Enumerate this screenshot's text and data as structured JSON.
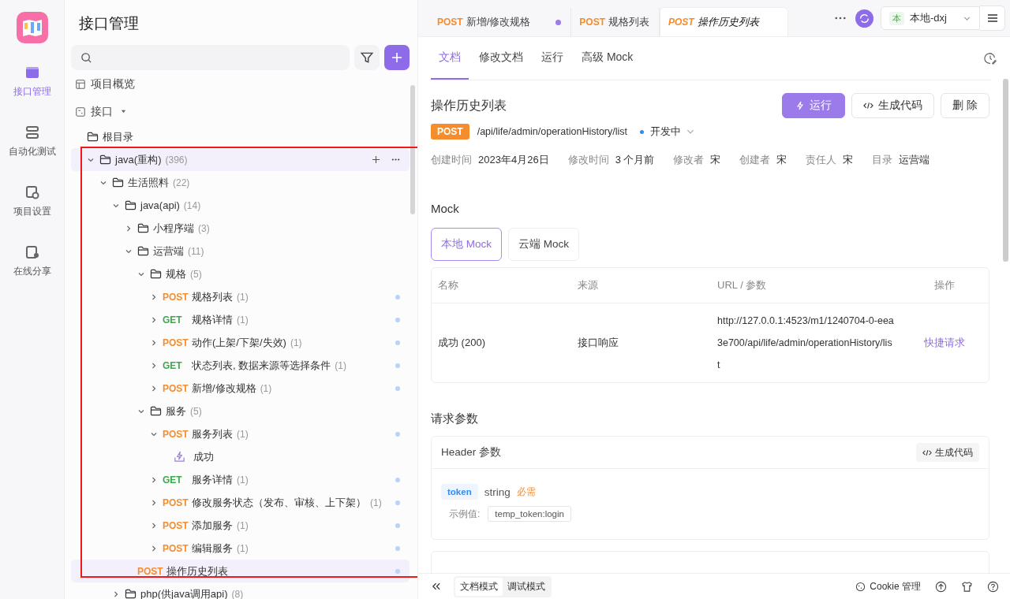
{
  "rail": [
    {
      "label": "接口管理",
      "selected": true
    },
    {
      "label": "自动化测试",
      "selected": false
    },
    {
      "label": "项目设置",
      "selected": false
    },
    {
      "label": "在线分享",
      "selected": false
    }
  ],
  "panel": {
    "title": "接口管理",
    "nav": [
      {
        "label": "项目概览",
        "dropdown": false
      },
      {
        "label": "接口",
        "dropdown": true
      }
    ]
  },
  "tree": [
    {
      "kind": "folder",
      "label": "根目录"
    },
    {
      "kind": "folder",
      "label": "java(重构)",
      "count": "(396)",
      "expanded": true,
      "hovered": true,
      "children": [
        {
          "kind": "folder",
          "label": "生活照料",
          "count": "(22)",
          "expanded": true,
          "children": [
            {
              "kind": "folder",
              "label": "java(api)",
              "count": "(14)",
              "expanded": true,
              "children": [
                {
                  "kind": "folder",
                  "label": "小程序端",
                  "count": "(3)",
                  "expanded": false
                },
                {
                  "kind": "folder",
                  "label": "运营端",
                  "count": "(11)",
                  "expanded": true,
                  "children": [
                    {
                      "kind": "folder",
                      "label": "规格",
                      "count": "(5)",
                      "expanded": true,
                      "children": [
                        {
                          "kind": "endpoint",
                          "method": "POST",
                          "label": "规格列表",
                          "count": "(1)",
                          "expanded": false,
                          "dot": true,
                          "selected": false
                        },
                        {
                          "kind": "endpoint",
                          "method": "GET",
                          "label": "规格详情",
                          "count": "(1)",
                          "expanded": false,
                          "dot": true,
                          "selected": false
                        },
                        {
                          "kind": "endpoint",
                          "method": "POST",
                          "label": "动作(上架/下架/失效)",
                          "count": "(1)",
                          "expanded": false,
                          "dot": true,
                          "selected": false
                        },
                        {
                          "kind": "endpoint",
                          "method": "GET",
                          "label": "状态列表, 数据来源等选择条件",
                          "count": "(1)",
                          "expanded": false,
                          "dot": true,
                          "selected": false
                        },
                        {
                          "kind": "endpoint",
                          "method": "POST",
                          "label": "新增/修改规格",
                          "count": "(1)",
                          "expanded": false,
                          "dot": true,
                          "selected": false
                        }
                      ]
                    },
                    {
                      "kind": "folder",
                      "label": "服务",
                      "count": "(5)",
                      "expanded": true,
                      "children": [
                        {
                          "kind": "endpoint",
                          "method": "POST",
                          "label": "服务列表",
                          "count": "(1)",
                          "expanded": true,
                          "dot": true,
                          "selected": false,
                          "children": [
                            {
                              "kind": "mock",
                              "label": "成功"
                            }
                          ]
                        },
                        {
                          "kind": "endpoint",
                          "method": "GET",
                          "label": "服务详情",
                          "count": "(1)",
                          "expanded": false,
                          "dot": true,
                          "selected": false
                        },
                        {
                          "kind": "endpoint",
                          "method": "POST",
                          "label": "修改服务状态（发布、审核、上下架）",
                          "count": "(1)",
                          "expanded": false,
                          "dot": true,
                          "selected": false
                        },
                        {
                          "kind": "endpoint",
                          "method": "POST",
                          "label": "添加服务",
                          "count": "(1)",
                          "expanded": false,
                          "dot": true,
                          "selected": false
                        },
                        {
                          "kind": "endpoint",
                          "method": "POST",
                          "label": "编辑服务",
                          "count": "(1)",
                          "expanded": false,
                          "dot": true,
                          "selected": false
                        }
                      ]
                    },
                    {
                      "kind": "endpoint",
                      "method": "POST",
                      "label": "操作历史列表",
                      "dot": true,
                      "selected": true
                    }
                  ]
                }
              ]
            },
            {
              "kind": "folder",
              "label": "php(供java调用api)",
              "count": "(8)",
              "expanded": false
            }
          ]
        }
      ]
    }
  ],
  "highlight_frame": true,
  "tabs": [
    {
      "method": "POST",
      "label": "新增/修改规格",
      "unsaved": true,
      "preview": false,
      "selected": false
    },
    {
      "method": "POST",
      "label": "规格列表",
      "unsaved": false,
      "preview": false,
      "selected": false
    },
    {
      "method": "POST",
      "label": "操作历史列表",
      "unsaved": false,
      "preview": true,
      "selected": true
    }
  ],
  "env": {
    "badge": "本",
    "name": "本地-dxj"
  },
  "doc_tabs": [
    {
      "label": "文档",
      "selected": true
    },
    {
      "label": "修改文档",
      "selected": false
    },
    {
      "label": "运行",
      "selected": false
    },
    {
      "label": "高级 Mock",
      "selected": false
    }
  ],
  "api": {
    "title": "操作历史列表",
    "method": "POST",
    "path": "/api/life/admin/operationHistory/list",
    "status": "开发中",
    "buttons": [
      {
        "kind": "run",
        "label": "运行"
      },
      {
        "kind": "code",
        "label": "生成代码"
      },
      {
        "kind": "plain",
        "label": "删 除"
      }
    ],
    "meta": [
      {
        "label": "创建时间",
        "value": "2023年4月26日"
      },
      {
        "label": "修改时间",
        "value": "3 个月前"
      },
      {
        "label": "修改者",
        "value": "宋"
      },
      {
        "label": "创建者",
        "value": "宋"
      },
      {
        "label": "责任人",
        "value": "宋"
      },
      {
        "label": "目录",
        "value": "运营端"
      }
    ]
  },
  "mock": {
    "heading": "Mock",
    "tabs": [
      {
        "label": "本地 Mock",
        "selected": true
      },
      {
        "label": "云端 Mock",
        "selected": false
      }
    ],
    "columns": [
      "名称",
      "来源",
      "URL / 参数",
      "操作"
    ],
    "rows": [
      {
        "name": "成功 (200)",
        "source": "接口响应",
        "url": "http://127.0.0.1:4523/m1/1240704-0-eea3e700/api/life/admin/operationHistory/list",
        "action": "快捷请求"
      }
    ]
  },
  "params": {
    "heading": "请求参数",
    "header_title": "Header 参数",
    "code_button": "生成代码",
    "items": [
      {
        "name": "token",
        "type": "string",
        "required": "必需",
        "example_label": "示例值:",
        "example": "temp_token:login"
      }
    ]
  },
  "footer": {
    "modes": [
      {
        "label": "文档模式",
        "selected": true
      },
      {
        "label": "调试模式",
        "selected": false
      }
    ],
    "cookie": "Cookie 管理"
  }
}
